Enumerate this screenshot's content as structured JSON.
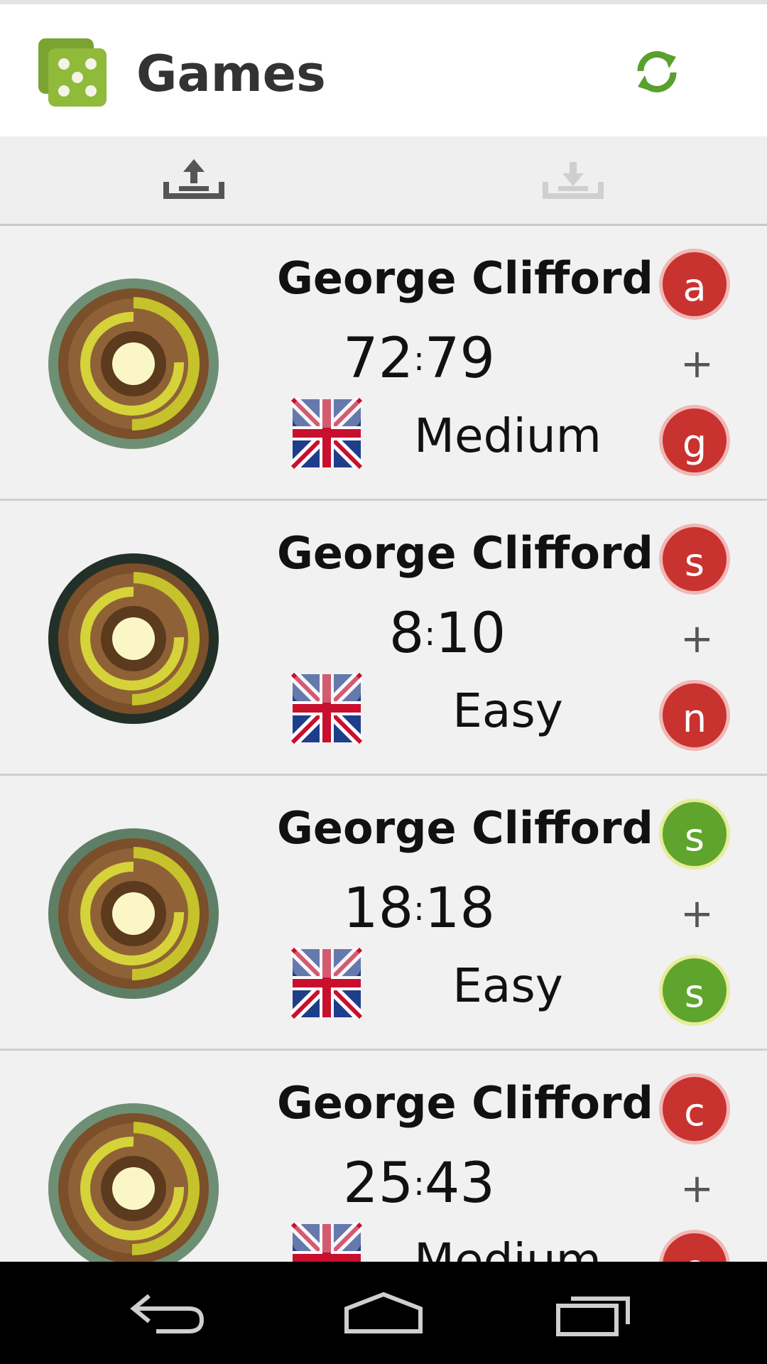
{
  "header": {
    "title": "Games",
    "app_icon": "dice-icon",
    "refresh_icon": "refresh-icon",
    "accent": "#8cb431"
  },
  "toolbar": {
    "upload_icon": "upload-icon",
    "download_icon": "download-icon"
  },
  "games": [
    {
      "player": "George Clifford",
      "score_left": "72",
      "score_right": "79",
      "difficulty": "Medium",
      "language": "flag-uk-us-icon",
      "letter_top": "a",
      "letter_bottom": "g",
      "letter_color": "red"
    },
    {
      "player": "George Clifford",
      "score_left": "8",
      "score_right": "10",
      "difficulty": "Easy",
      "language": "flag-uk-us-icon",
      "letter_top": "s",
      "letter_bottom": "n",
      "letter_color": "red"
    },
    {
      "player": "George Clifford",
      "score_left": "18",
      "score_right": "18",
      "difficulty": "Easy",
      "language": "flag-uk-us-icon",
      "letter_top": "s",
      "letter_bottom": "s",
      "letter_color": "green"
    },
    {
      "player": "George Clifford",
      "score_left": "25",
      "score_right": "43",
      "difficulty": "Medium",
      "language": "flag-uk-us-icon",
      "letter_top": "c",
      "letter_bottom": "e",
      "letter_color": "red"
    }
  ],
  "plus_sign": "+",
  "score_separator": ":",
  "navigation": {
    "back_icon": "back-icon",
    "home_icon": "home-icon",
    "recents_icon": "recents-icon"
  }
}
